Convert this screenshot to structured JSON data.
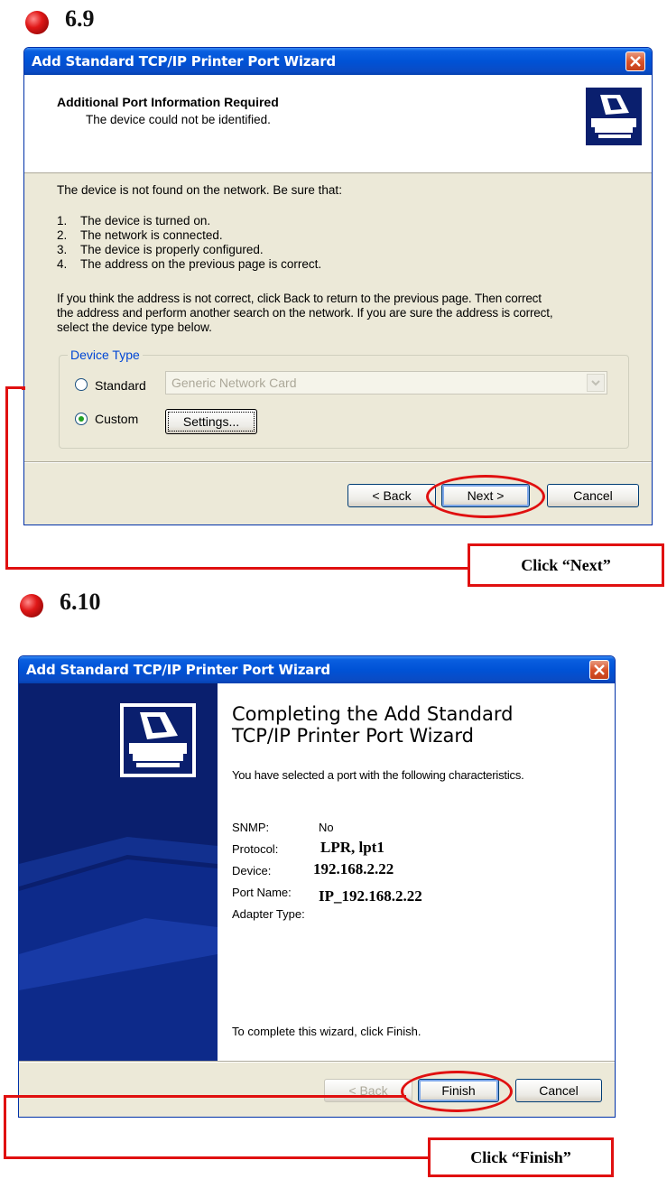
{
  "step1": {
    "number": "6.9",
    "window_title": "Add Standard TCP/IP Printer Port Wizard",
    "header_title": "Additional Port Information Required",
    "header_subtitle": "The device could not be identified.",
    "intro": "The device is not found on the network.  Be sure that:",
    "list": [
      {
        "num": "1.",
        "text": "The device is turned on."
      },
      {
        "num": "2.",
        "text": "The network is connected."
      },
      {
        "num": "3.",
        "text": "The device is properly configured."
      },
      {
        "num": "4.",
        "text": "The address on the previous page is correct."
      }
    ],
    "para": [
      "If you think the address is not correct, click Back to return to the previous page.  Then correct",
      "the address and perform another search on the network.  If you are sure the address is correct,",
      "select the device type below."
    ],
    "group_label": "Device Type",
    "radio_standard": "Standard",
    "standard_select_value": "Generic Network Card",
    "radio_custom": "Custom",
    "settings_button": "Settings...",
    "back_button": "< Back",
    "next_button": "Next >",
    "cancel_button": "Cancel",
    "callout": "Click  “Next”"
  },
  "step2": {
    "number": "6.10",
    "window_title": "Add Standard TCP/IP Printer Port Wizard",
    "heading_line1": "Completing the Add Standard",
    "heading_line2": "TCP/IP Printer Port Wizard",
    "selected_text": "You have selected a port with the following characteristics.",
    "props": [
      {
        "label": "SNMP:",
        "value": "No"
      },
      {
        "label": "Protocol:",
        "value": "LPR, lpt1"
      },
      {
        "label": "Device:",
        "value": "192.168.2.22"
      },
      {
        "label": "Port Name:",
        "value": "IP_192.168.2.22"
      },
      {
        "label": "Adapter Type:",
        "value": ""
      }
    ],
    "complete_text": "To complete this wizard, click Finish.",
    "back_button": "< Back",
    "finish_button": "Finish",
    "cancel_button": "Cancel",
    "callout": "Click  “Finish”"
  },
  "colors": {
    "title_blue": "#0052d6",
    "dialog_bg": "#ece9d8",
    "annotation_red": "#e01010",
    "sidebar_navy": "#0a1f6e"
  },
  "icons": [
    "bullet-icon",
    "close-icon",
    "printer-wizard-icon"
  ]
}
